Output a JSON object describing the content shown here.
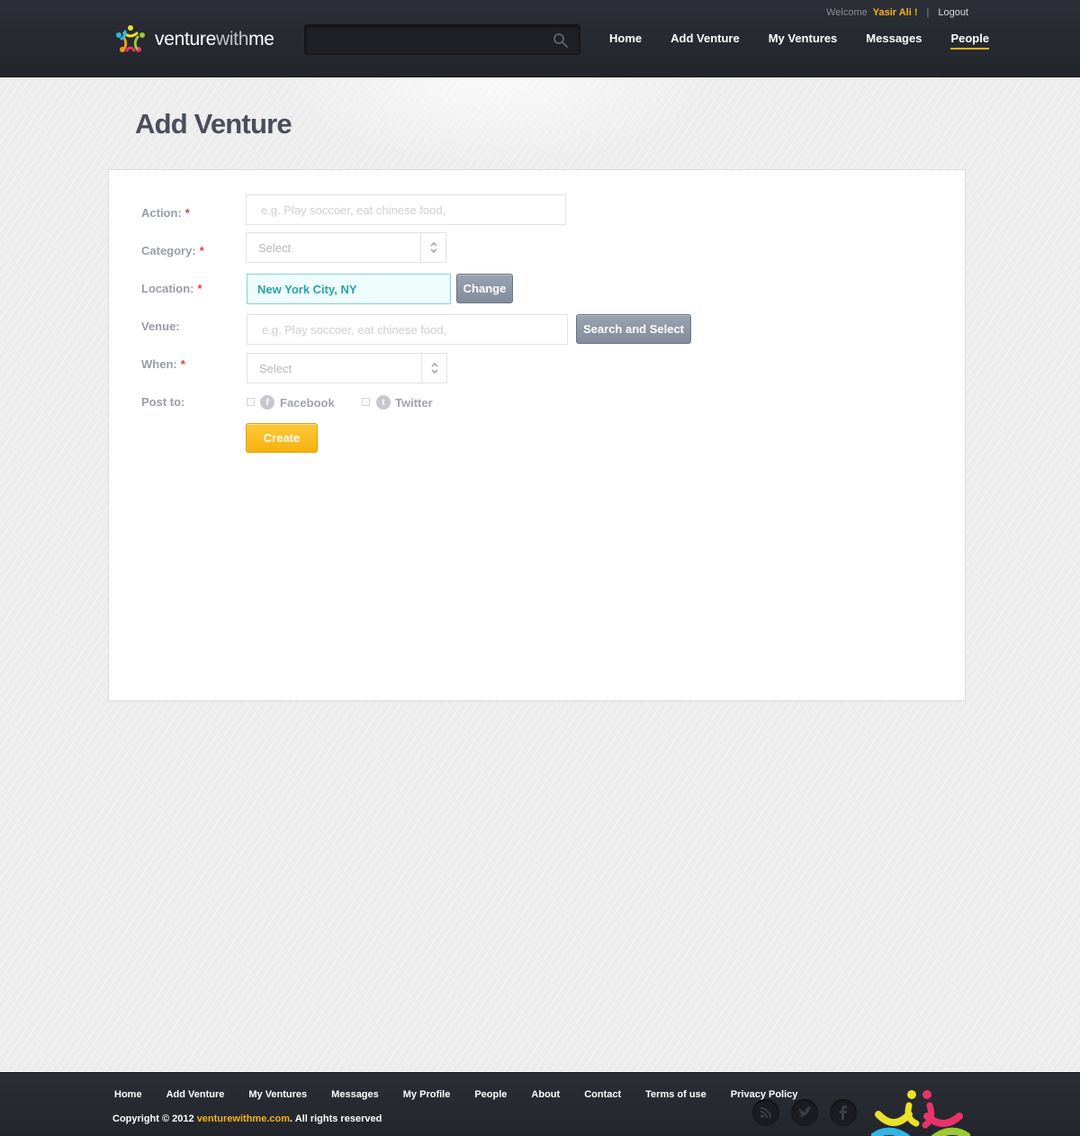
{
  "header": {
    "brand_strong": "venture",
    "brand_mid": "with",
    "brand_end": "me",
    "search_placeholder": "",
    "welcome": "Welcome",
    "user": "Yasir Ali !",
    "separator": "|",
    "logout": "Logout",
    "nav": [
      "Home",
      "Add Venture",
      "My Ventures",
      "Messages",
      "People"
    ],
    "active_nav": "People"
  },
  "page": {
    "title": "Add Venture"
  },
  "form": {
    "action": {
      "label": "Action:",
      "required": "*",
      "placeholder": "e.g. Play soccoer, eat chinese food,"
    },
    "category": {
      "label": "Category:",
      "required": "*",
      "selected": "Select"
    },
    "location": {
      "label": "Location:",
      "required": "*",
      "value": "New York City, NY",
      "change_label": "Change"
    },
    "venue": {
      "label": "Venue:",
      "placeholder": "e.g. Play soccoer, eat chinese food,",
      "button_label": "Search and Select"
    },
    "when": {
      "label": "When:",
      "required": "*",
      "selected": "Select"
    },
    "post_to": {
      "label": "Post to:",
      "facebook": "Facebook",
      "twitter": "Twitter"
    },
    "create_label": "Create"
  },
  "footer": {
    "nav": [
      "Home",
      "Add Venture",
      "My Ventures",
      "Messages",
      "My Profile",
      "People",
      "About",
      "Contact",
      "Terms of use",
      "Privacy Policy"
    ],
    "copyright_prefix": "Copyright © 2012 ",
    "copyright_site": "venturewithme.com",
    "copyright_suffix": ". All rights reserved"
  },
  "colors": {
    "accent": "#f5b21b",
    "header_bg": "#2a2d34",
    "required": "#e23b3b",
    "location_text": "#2aa2a6"
  }
}
